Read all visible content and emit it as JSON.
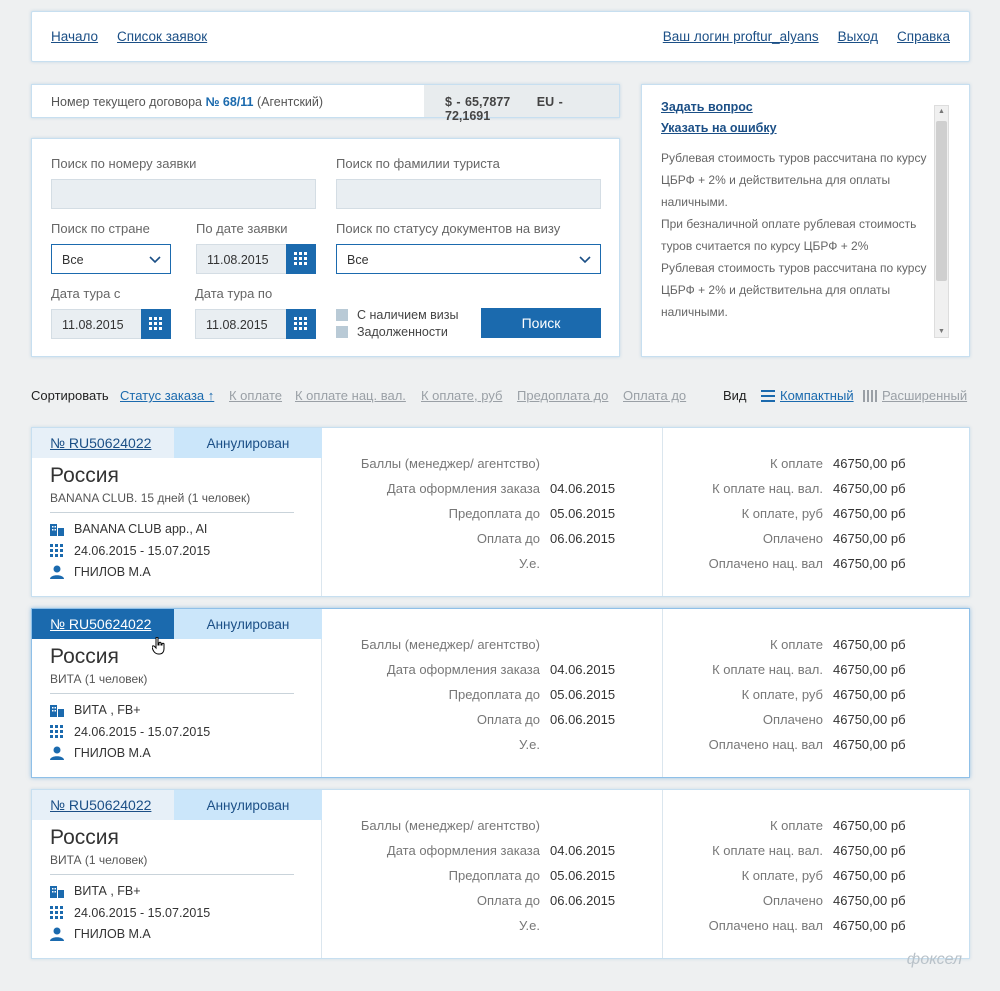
{
  "nav": {
    "home": "Начало",
    "requests": "Список заявок",
    "login": "Ваш логин proftur_alyans",
    "logout": "Выход",
    "help": "Справка"
  },
  "contract": {
    "label": "Номер текущего договора",
    "number": "№ 68/11",
    "type": "(Агентский)",
    "usd": "$ - 65,7877",
    "eur": "EU - 72,1691"
  },
  "search": {
    "by_number_label": "Поиск по номеру заявки",
    "by_number_value": "",
    "by_surname_label": "Поиск по фамилии туриста",
    "by_surname_value": "",
    "by_country_label": "Поиск по стране",
    "by_country_value": "Все",
    "by_date_label": "По дате заявки",
    "by_date_value": "11.08.2015",
    "by_visa_label": "Поиск по статусу документов на визу",
    "by_visa_value": "Все",
    "tour_from_label": "Дата тура с",
    "tour_from_value": "11.08.2015",
    "tour_to_label": "Дата тура по",
    "tour_to_value": "11.08.2015",
    "visa_check": "С наличием визы",
    "debt_check": "Задолженности",
    "submit": "Поиск"
  },
  "info": {
    "ask": "Задать вопрос",
    "report": "Указать на ошибку",
    "p1": "Рублевая стоимость туров рассчитана по курсу ЦБРФ + 2% и действительна для оплаты наличными.",
    "p2": "При безналичной оплате рублевая стоимость туров считается по курсу ЦБРФ + 2%",
    "p3": "Рублевая стоимость туров рассчитана по курсу ЦБРФ + 2% и действительна для оплаты наличными."
  },
  "sort": {
    "label": "Сортировать",
    "options": [
      "Статус заказа ↑",
      "К оплате",
      "К оплате нац. вал.",
      "К оплате, руб",
      "Предоплата до",
      "Оплата до"
    ],
    "view_label": "Вид",
    "compact": "Компактный",
    "extended": "Расширенный"
  },
  "labels": {
    "points": "Баллы (менеджер/ агентство)",
    "order_date": "Дата оформления заказа",
    "prepay": "Предоплата до",
    "pay": "Оплата до",
    "ue": "У.е.",
    "to_pay": "К оплате",
    "to_pay_nat": "К оплате нац. вал.",
    "to_pay_rub": "К оплате, руб",
    "paid": "Оплачено",
    "paid_nat": "Оплачено нац. вал"
  },
  "orders": [
    {
      "number": "№ RU50624022",
      "status": "Аннулирован",
      "country": "Россия",
      "tour": "BANANA CLUB. 15 дней (1 человек)",
      "hotel": "BANANA CLUB app., AI",
      "dates": "24.06.2015 - 15.07.2015",
      "tourist": "ГНИЛОВ М.А",
      "order_date": "04.06.2015",
      "prepay": "05.06.2015",
      "pay": "06.06.2015",
      "to_pay": "46750,00 рб",
      "to_pay_nat": "46750,00 рб",
      "to_pay_rub": "46750,00 рб",
      "paid": "46750,00 рб",
      "paid_nat": "46750,00 рб"
    },
    {
      "number": "№ RU50624022",
      "status": "Аннулирован",
      "country": "Россия",
      "tour": "ВИТА (1 человек)",
      "hotel": "ВИТА , FB+",
      "dates": "24.06.2015 - 15.07.2015",
      "tourist": "ГНИЛОВ М.А",
      "order_date": "04.06.2015",
      "prepay": "05.06.2015",
      "pay": "06.06.2015",
      "to_pay": "46750,00 рб",
      "to_pay_nat": "46750,00 рб",
      "to_pay_rub": "46750,00 рб",
      "paid": "46750,00 рб",
      "paid_nat": "46750,00 рб"
    },
    {
      "number": "№ RU50624022",
      "status": "Аннулирован",
      "country": "Россия",
      "tour": "ВИТА (1 человек)",
      "hotel": "ВИТА , FB+",
      "dates": "24.06.2015 - 15.07.2015",
      "tourist": "ГНИЛОВ М.А",
      "order_date": "04.06.2015",
      "prepay": "05.06.2015",
      "pay": "06.06.2015",
      "to_pay": "46750,00 рб",
      "to_pay_nat": "46750,00 рб",
      "to_pay_rub": "46750,00 рб",
      "paid": "46750,00 рб",
      "paid_nat": "46750,00 рб"
    }
  ],
  "watermark": "фоксел",
  "colors": {
    "accent": "#1b6aae",
    "status_bg": "#cbe6fa",
    "page_bg": "#eef0f1"
  }
}
